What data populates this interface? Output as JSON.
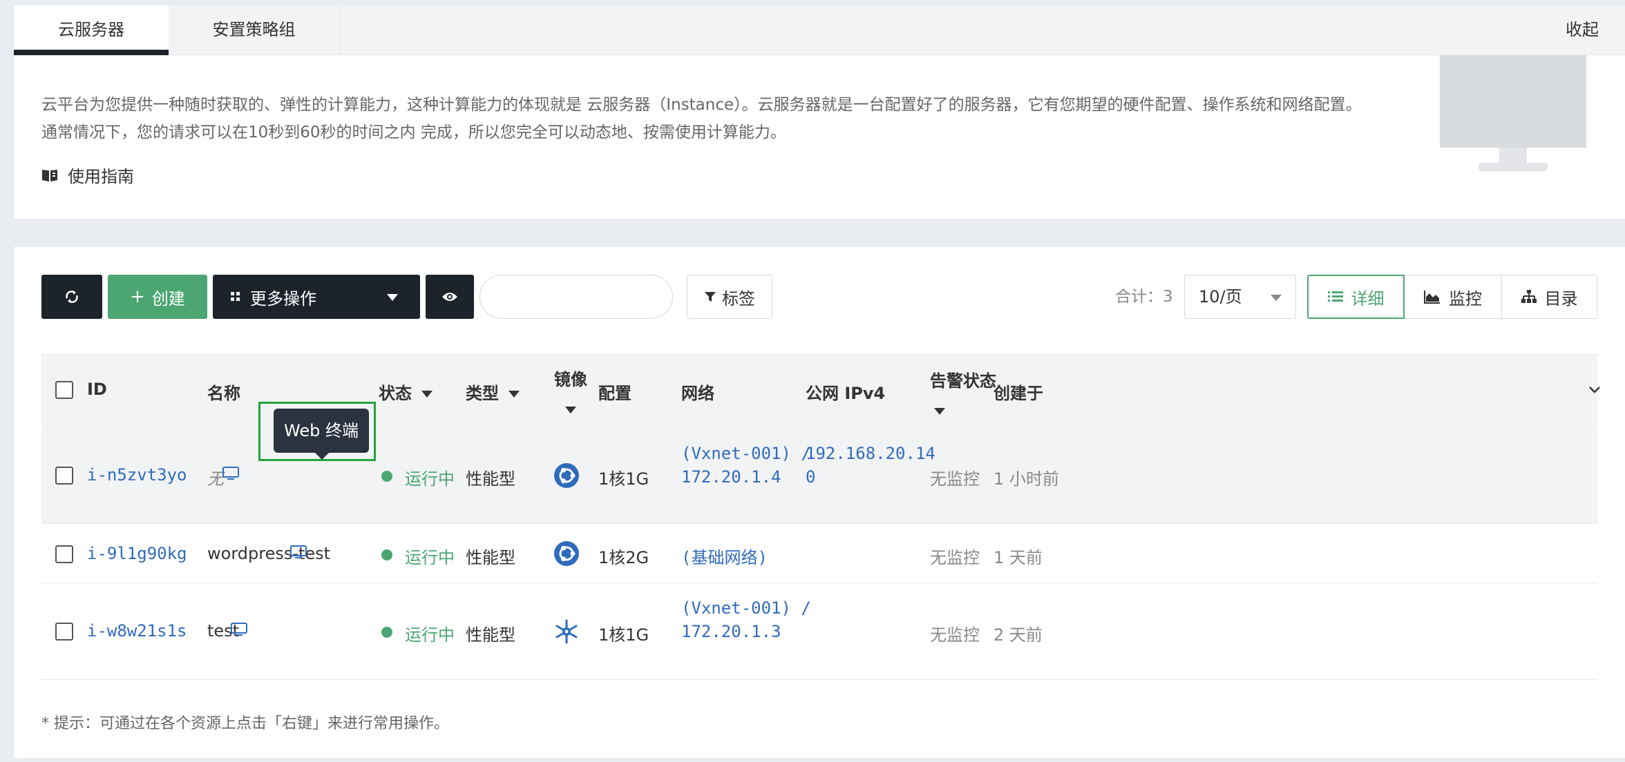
{
  "tabs": [
    {
      "label": "云服务器",
      "active": true
    },
    {
      "label": "安置策略组",
      "active": false
    }
  ],
  "collapse_label": "收起",
  "intro": {
    "text": "云平台为您提供一种随时获取的、弹性的计算能力，这种计算能力的体现就是 云服务器（Instance）。云服务器就是一台配置好了的服务器，它有您期望的硬件配置、操作系统和网络配置。通常情况下，您的请求可以在10秒到60秒的时间之内 完成，所以您完全可以动态地、按需使用计算能力。",
    "guide_label": "使用指南"
  },
  "toolbar": {
    "refresh_icon": "refresh-icon",
    "create_label": "创建",
    "more_label": "更多操作",
    "search_placeholder": "",
    "tag_label": "标签",
    "total_label": "合计：3",
    "per_page": "10/页",
    "views": [
      "详细",
      "监控",
      "目录"
    ]
  },
  "table": {
    "columns": {
      "id": "ID",
      "name": "名称",
      "status": "状态",
      "type": "类型",
      "image": "镜像",
      "config": "配置",
      "network": "网络",
      "ipv4": "公网 IPv4",
      "alarm": "告警状态",
      "created": "创建于"
    },
    "rows": [
      {
        "id": "i-n5zvt3yo",
        "name": "无",
        "status": "运行中",
        "type": "性能型",
        "image_icon": "ubuntu-icon",
        "config": "1核1G",
        "network_line1": "(Vxnet-001) /",
        "network_line2": "172.20.1.4",
        "ipv4_line1": "192.168.20.14",
        "ipv4_line2": "0",
        "alarm": "无监控",
        "created": "1 小时前"
      },
      {
        "id": "i-9l1g90kg",
        "name": "wordpress-test",
        "status": "运行中",
        "type": "性能型",
        "image_icon": "ubuntu-icon",
        "config": "1核2G",
        "network_line1": "(基础网络)",
        "network_line2": "",
        "ipv4_line1": "",
        "ipv4_line2": "",
        "alarm": "无监控",
        "created": "1 天前"
      },
      {
        "id": "i-w8w21s1s",
        "name": "test",
        "status": "运行中",
        "type": "性能型",
        "image_icon": "snowflake-icon",
        "config": "1核1G",
        "network_line1": "(Vxnet-001) /",
        "network_line2": "172.20.1.3",
        "ipv4_line1": "",
        "ipv4_line2": "",
        "alarm": "无监控",
        "created": "2 天前"
      }
    ]
  },
  "tooltip": "Web 终端",
  "hint": "* 提示：可通过在各个资源上点击「右键」来进行常用操作。",
  "colors": {
    "accent_green": "#4ba672",
    "dark": "#1d232b",
    "link": "#2f6bbd",
    "highlight_box": "#24a33e"
  }
}
